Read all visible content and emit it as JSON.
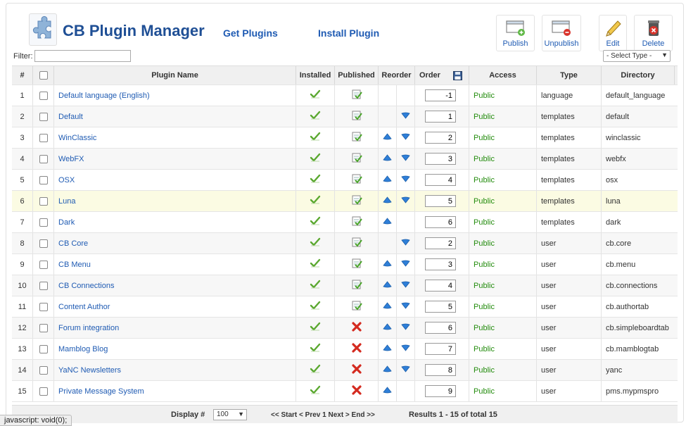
{
  "header": {
    "title": "CB Plugin Manager",
    "get_plugins": "Get Plugins",
    "install_plugin": "Install Plugin"
  },
  "toolbar": {
    "publish": "Publish",
    "unpublish": "Unpublish",
    "edit": "Edit",
    "delete": "Delete"
  },
  "filter": {
    "label": "Filter:",
    "value": "",
    "select_type": "- Select Type -"
  },
  "columns": {
    "num": "#",
    "name": "Plugin Name",
    "installed": "Installed",
    "published": "Published",
    "reorder": "Reorder",
    "order": "Order",
    "access": "Access",
    "type": "Type",
    "directory": "Directory"
  },
  "rows": [
    {
      "num": "1",
      "name": "Default language (English)",
      "installed": true,
      "published": true,
      "up": false,
      "down": false,
      "order": "-1",
      "access": "Public",
      "type": "language",
      "directory": "default_language"
    },
    {
      "num": "2",
      "name": "Default",
      "installed": true,
      "published": true,
      "up": false,
      "down": true,
      "order": "1",
      "access": "Public",
      "type": "templates",
      "directory": "default"
    },
    {
      "num": "3",
      "name": "WinClassic",
      "installed": true,
      "published": true,
      "up": true,
      "down": true,
      "order": "2",
      "access": "Public",
      "type": "templates",
      "directory": "winclassic"
    },
    {
      "num": "4",
      "name": "WebFX",
      "installed": true,
      "published": true,
      "up": true,
      "down": true,
      "order": "3",
      "access": "Public",
      "type": "templates",
      "directory": "webfx"
    },
    {
      "num": "5",
      "name": "OSX",
      "installed": true,
      "published": true,
      "up": true,
      "down": true,
      "order": "4",
      "access": "Public",
      "type": "templates",
      "directory": "osx"
    },
    {
      "num": "6",
      "name": "Luna",
      "installed": true,
      "published": true,
      "up": true,
      "down": true,
      "order": "5",
      "access": "Public",
      "type": "templates",
      "directory": "luna",
      "highlight": true
    },
    {
      "num": "7",
      "name": "Dark",
      "installed": true,
      "published": true,
      "up": true,
      "down": false,
      "order": "6",
      "access": "Public",
      "type": "templates",
      "directory": "dark"
    },
    {
      "num": "8",
      "name": "CB Core",
      "installed": true,
      "published": true,
      "up": false,
      "down": true,
      "order": "2",
      "access": "Public",
      "type": "user",
      "directory": "cb.core"
    },
    {
      "num": "9",
      "name": "CB Menu",
      "installed": true,
      "published": true,
      "up": true,
      "down": true,
      "order": "3",
      "access": "Public",
      "type": "user",
      "directory": "cb.menu"
    },
    {
      "num": "10",
      "name": "CB Connections",
      "installed": true,
      "published": true,
      "up": true,
      "down": true,
      "order": "4",
      "access": "Public",
      "type": "user",
      "directory": "cb.connections"
    },
    {
      "num": "11",
      "name": "Content Author",
      "installed": true,
      "published": true,
      "up": true,
      "down": true,
      "order": "5",
      "access": "Public",
      "type": "user",
      "directory": "cb.authortab"
    },
    {
      "num": "12",
      "name": "Forum integration",
      "installed": true,
      "published": false,
      "up": true,
      "down": true,
      "order": "6",
      "access": "Public",
      "type": "user",
      "directory": "cb.simpleboardtab"
    },
    {
      "num": "13",
      "name": "Mamblog Blog",
      "installed": true,
      "published": false,
      "up": true,
      "down": true,
      "order": "7",
      "access": "Public",
      "type": "user",
      "directory": "cb.mamblogtab"
    },
    {
      "num": "14",
      "name": "YaNC Newsletters",
      "installed": true,
      "published": false,
      "up": true,
      "down": true,
      "order": "8",
      "access": "Public",
      "type": "user",
      "directory": "yanc"
    },
    {
      "num": "15",
      "name": "Private Message System",
      "installed": true,
      "published": false,
      "up": true,
      "down": false,
      "order": "9",
      "access": "Public",
      "type": "user",
      "directory": "pms.mypmspro"
    }
  ],
  "footer": {
    "display_label": "Display #",
    "display_value": "100",
    "nav_start": "<< Start",
    "nav_prev": "< Prev",
    "nav_pages": "1",
    "nav_next": "Next >",
    "nav_end": "End >>",
    "results": "Results 1 - 15 of total 15"
  },
  "status_bar": "javascript: void(0);"
}
